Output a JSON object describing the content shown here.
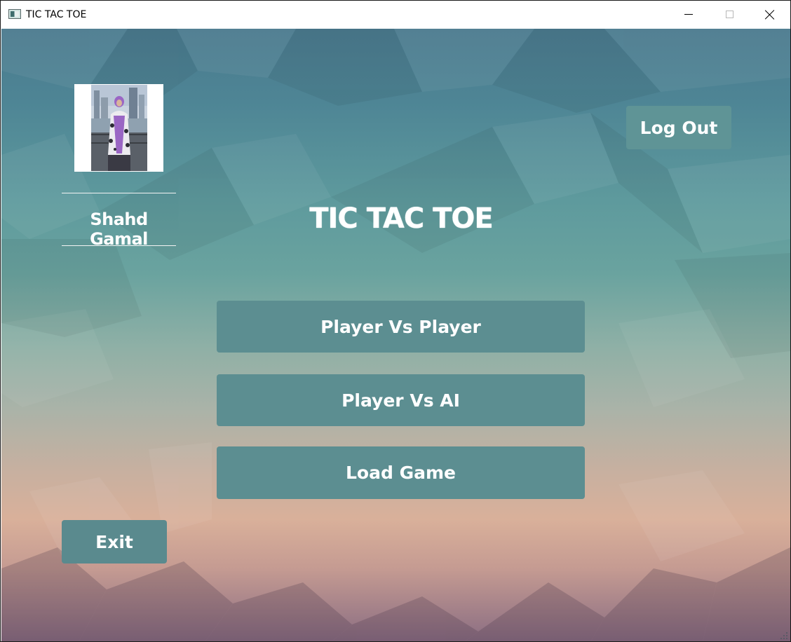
{
  "window": {
    "title": "TIC TAC TOE"
  },
  "user": {
    "name": "Shahd Gamal"
  },
  "game": {
    "title": "TIC TAC TOE"
  },
  "buttons": {
    "logout": "Log Out",
    "player_vs_player": "Player Vs Player",
    "player_vs_ai": "Player Vs AI",
    "load_game": "Load Game",
    "exit": "Exit"
  },
  "colors": {
    "button": "#5c8e91",
    "text": "#ffffff"
  }
}
